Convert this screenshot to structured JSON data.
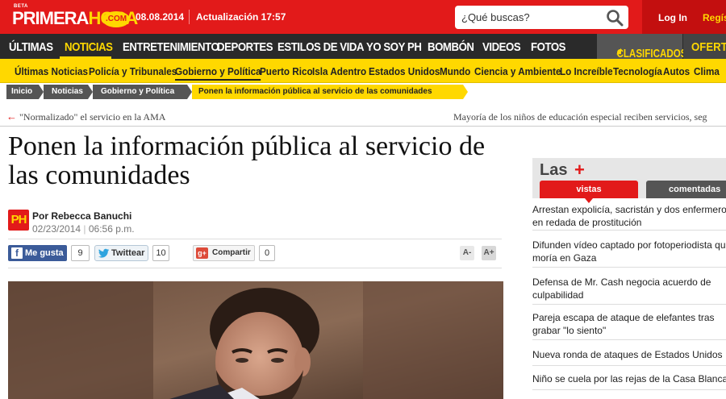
{
  "header": {
    "logo_beta": "BETA",
    "logo_part1": "PRIMERA",
    "logo_part2": "HORA",
    "logo_dotcom": ".COM",
    "date": "08.08.2014",
    "update": "Actualización 17:57",
    "search_placeholder": "¿Qué buscas?",
    "login": "Log In",
    "register": "Regís"
  },
  "main_nav": {
    "items": [
      "ÚLTIMAS",
      "NOTICIAS",
      "ENTRETENIMIENTO",
      "DEPORTES",
      "ESTILOS DE VIDA",
      "YO SOY PH",
      "BOMBÓN",
      "VIDEOS",
      "FOTOS"
    ],
    "classifieds": "CLASIFICADOS",
    "offers": "OFERTAS"
  },
  "sub_nav": {
    "items": [
      "Últimas Noticias",
      "Policía y Tribunales",
      "Gobierno y Política",
      "Puerto Rico",
      "Isla Adentro",
      "Estados Unidos",
      "Mundo",
      "Ciencia y Ambiente",
      "Lo Increíble",
      "Tecnología",
      "Autos",
      "Clima"
    ]
  },
  "breadcrumb": [
    "Inicio",
    "Noticias",
    "Gobierno y Política",
    "Ponen la información pública al servicio de las comunidades"
  ],
  "article_nav": {
    "prev": "\"Normalizado\" el servicio en la AMA",
    "next": "Mayoría de los niños de educación especial reciben servicios, seg"
  },
  "article": {
    "headline": "Ponen la información pública al servicio de las comunidades",
    "author_logo": "PH",
    "author": "Por Rebecca Banuchi",
    "date": "02/23/2014",
    "time": "06:56 p.m.",
    "date_sep": "|"
  },
  "social": {
    "like_label": "Me gusta",
    "like_count": "9",
    "tweet_label": "Twittear",
    "tweet_count": "10",
    "share_label": "Compartir",
    "share_count": "0",
    "font_smaller": "A-",
    "font_larger": "A+"
  },
  "sidebar": {
    "title": "Las",
    "plus": "+",
    "tab_viewed": "vistas",
    "tab_commented": "comentadas",
    "stories": [
      "Arrestan expolicía, sacristán y dos enfermeros en redada de prostitución",
      "Difunden vídeo captado por fotoperiodista que moría en Gaza",
      "Defensa de Mr. Cash negocia acuerdo de culpabilidad",
      "Pareja escapa de ataque de elefantes tras grabar \"lo siento\"",
      "Nueva ronda de ataques de Estados Unidos",
      "Niño se cuela por las rejas de la Casa Blanca"
    ]
  },
  "colors": {
    "brand_red": "#e21a1a",
    "brand_yellow": "#ffd800",
    "nav_dark": "#2a2a2a"
  }
}
